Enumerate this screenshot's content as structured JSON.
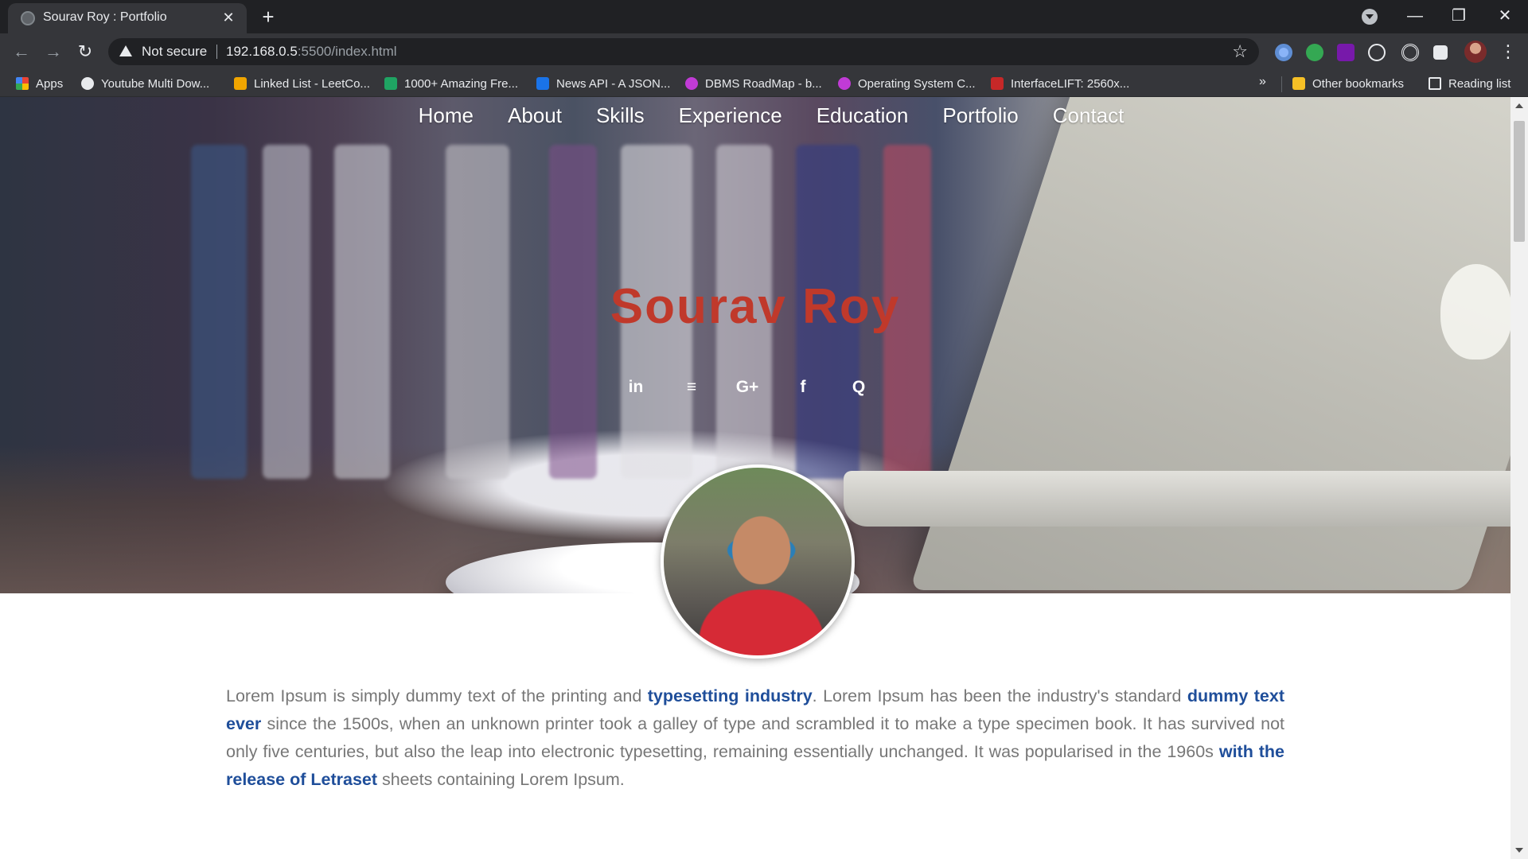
{
  "browser": {
    "tab_title": "Sourav Roy : Portfolio",
    "tab_close": "✕",
    "new_tab": "+",
    "security_label": "Not secure",
    "url_host": "192.168.0.5",
    "url_rest": ":5500/index.html",
    "window_controls": {
      "minimize": "—",
      "maximize": "❐",
      "close": "✕"
    },
    "bookmarks": [
      {
        "label": "Apps",
        "icon": "apps-grid-icon",
        "color": "#4285f4"
      },
      {
        "label": "Youtube Multi Dow...",
        "icon": "globe-icon",
        "color": "#e8eaed"
      },
      {
        "label": "Linked List - LeetCo...",
        "icon": "leetcode-icon",
        "color": "#f0a500"
      },
      {
        "label": "1000+ Amazing Fre...",
        "icon": "page-icon",
        "color": "#1fa463"
      },
      {
        "label": "News API - A JSON...",
        "icon": "news-icon",
        "color": "#1a73e8"
      },
      {
        "label": "DBMS RoadMap - b...",
        "icon": "m-icon",
        "color": "#c13bd6"
      },
      {
        "label": "Operating System C...",
        "icon": "m-icon",
        "color": "#c13bd6"
      },
      {
        "label": "InterfaceLIFT: 2560x...",
        "icon": "ifl-icon",
        "color": "#c62828"
      }
    ],
    "more_bookmarks": "»",
    "other_bookmarks": "Other bookmarks",
    "reading_list": "Reading list"
  },
  "page": {
    "nav": [
      "Home",
      "About",
      "Skills",
      "Experience",
      "Education",
      "Portfolio",
      "Contact"
    ],
    "name": "Sourav Roy",
    "name_color": "#c0392b",
    "social": [
      {
        "icon": "linkedin-icon",
        "glyph": "in"
      },
      {
        "icon": "stackoverflow-icon",
        "glyph": "≡"
      },
      {
        "icon": "google-plus-icon",
        "glyph": "G+"
      },
      {
        "icon": "facebook-icon",
        "glyph": "f"
      },
      {
        "icon": "quora-icon",
        "glyph": "Q"
      }
    ],
    "about": {
      "p1": "Lorem Ipsum is simply dummy text of the printing and ",
      "h1": "typesetting industry",
      "p2": ". Lorem Ipsum has been the industry's standard ",
      "h2": "dummy text ever",
      "p3": " since the 1500s, when an unknown printer took a galley of type and scrambled it to make a type specimen book. It has survived not only five centuries, but also the leap into electronic typesetting, remaining essentially unchanged. It was popularised in the 1960s ",
      "h3": "with the release of Letraset",
      "p4": " sheets containing Lorem Ipsum.",
      "highlight_color": "#1f4e9a"
    }
  }
}
